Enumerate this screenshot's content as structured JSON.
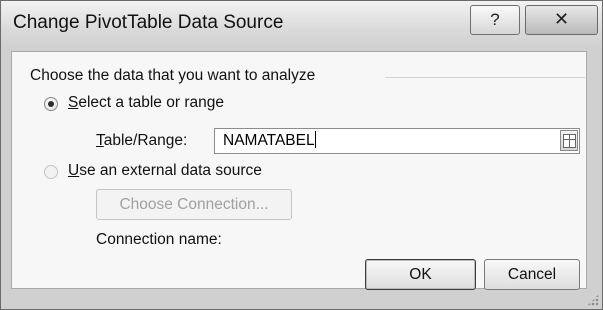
{
  "window": {
    "title": "Change PivotTable Data Source",
    "help_icon": "question-mark",
    "close_icon": "x-mark"
  },
  "dialog": {
    "group_label": "Choose the data that you want to analyze",
    "option_table": {
      "label_prefix": "S",
      "label_rest": "elect a table or range",
      "selected": true
    },
    "table_range": {
      "label_prefix": "T",
      "label_rest": "able/Range:",
      "value": "NAMATABEL",
      "picker_icon": "range-select-icon"
    },
    "option_external": {
      "label_prefix": "U",
      "label_rest": "se an external data source",
      "selected": false,
      "enabled": false
    },
    "choose_connection_label": "Choose Connection...",
    "connection_name_label": "Connection name:",
    "ok_label": "OK",
    "cancel_label": "Cancel"
  }
}
